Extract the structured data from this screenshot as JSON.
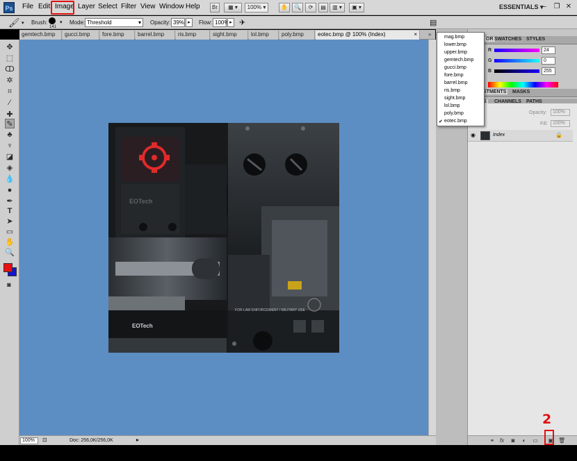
{
  "app": {
    "logo": "Ps",
    "workspace": "ESSENTIALS"
  },
  "menu": {
    "items": [
      "File",
      "Edit",
      "Image",
      "Layer",
      "Select",
      "Filter",
      "View",
      "Window",
      "Help"
    ],
    "highlighted": "Image",
    "bridge_button": "Br",
    "zoom": "100%"
  },
  "options_bar": {
    "brush_label": "Brush:",
    "brush_size": "141",
    "mode_label": "Mode:",
    "mode_value": "Threshold",
    "opacity_label": "Opacity:",
    "opacity_value": "39%",
    "flow_label": "Flow:",
    "flow_value": "100%"
  },
  "tabs": [
    {
      "label": "gemtech.bmp"
    },
    {
      "label": "gucci.bmp"
    },
    {
      "label": "fore.bmp"
    },
    {
      "label": "barrel.bmp"
    },
    {
      "label": "ris.bmp"
    },
    {
      "label": "sight.bmp"
    },
    {
      "label": "lol.bmp"
    },
    {
      "label": "poly.bmp"
    },
    {
      "label": "eotec.bmp @ 100% (Index)",
      "close": "×"
    }
  ],
  "tab_overflow": "»",
  "document_menu": {
    "items": [
      "mag.bmp",
      "lower.bmp",
      "upper.bmp",
      "gemtech.bmp",
      "gucci.bmp",
      "fore.bmp",
      "barrel.bmp",
      "ris.bmp",
      "sight.bmp",
      "lol.bmp",
      "poly.bmp",
      "eotec.bmp"
    ],
    "checked": "eotec.bmp",
    "check_mark": "✔"
  },
  "status": {
    "zoom": "100%",
    "doc": "Doc: 256,0K/256,0K"
  },
  "color_panel": {
    "tabs": [
      "OR",
      "SWATCHES",
      "STYLES"
    ],
    "channels": [
      {
        "label": "R",
        "value": "24"
      },
      {
        "label": "G",
        "value": "0"
      },
      {
        "label": "B",
        "value": "255"
      }
    ]
  },
  "adjust_panel": {
    "tabs": [
      "STMENTS",
      "MASKS"
    ]
  },
  "layers_panel": {
    "tabs": [
      "S",
      "CHANNELS",
      "PATHS"
    ],
    "opacity_label": "Opacity:",
    "opacity_value": "100%",
    "fill_label": "Fill:",
    "fill_value": "100%",
    "layer_name": "Index"
  },
  "artwork": {
    "brand": "EOTech",
    "caption": "FOR LAW ENFORCEMENT / MILITARY USE"
  },
  "annotation": {
    "step_number": "2"
  },
  "colors": {
    "canvas_bg": "#5d8ec3",
    "foreground": "#e81010",
    "background": "#1414d0",
    "highlight": "#e01010"
  }
}
